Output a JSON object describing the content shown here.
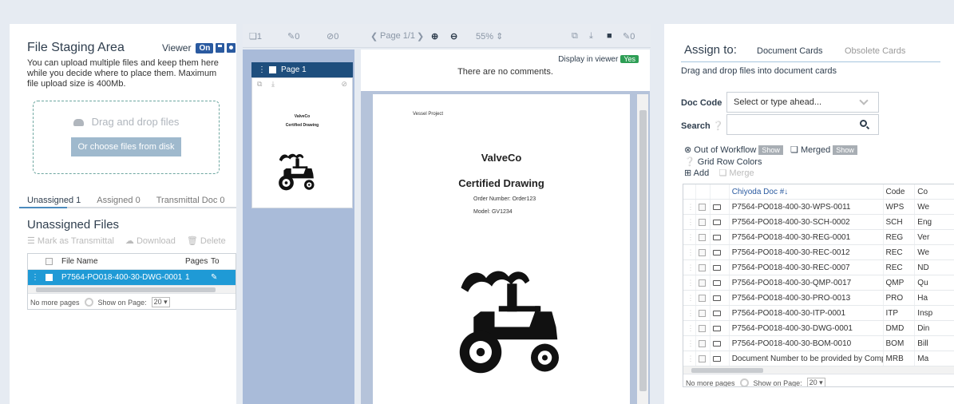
{
  "staging": {
    "title": "File Staging Area",
    "viewer_label": "Viewer",
    "viewer_toggle": "On",
    "description": "You can upload multiple files and keep them here while you decide where to place them. Maximum file upload size is 400Mb.",
    "drop_text": "Drag and drop files",
    "choose_button": "Or choose files from disk",
    "tabs": [
      "Unassigned 1",
      "Assigned 0",
      "Transmittal Doc 0"
    ],
    "unassigned_title": "Unassigned Files",
    "tools": {
      "mark": "Mark as Transmittal",
      "download": "Download",
      "delete": "Delete"
    },
    "table": {
      "headers": [
        "File Name",
        "Pages",
        "To"
      ],
      "rows": [
        {
          "file_name": "P7564-PO018-400-30-DWG-0001.pdf",
          "pages": "1"
        }
      ]
    },
    "pager": {
      "no_more": "No more pages",
      "show_label": "Show on Page:",
      "page_size": "20"
    }
  },
  "viewer_toolbar": {
    "pages_count": "1",
    "edits_count": "0",
    "voids_count": "0",
    "page_indicator": "Page 1/1",
    "zoom": "55%",
    "right_count": "0"
  },
  "thumbnail": {
    "label": "Page 1",
    "mini_title": "ValveCo",
    "mini_subtitle": "Certified Drawing"
  },
  "comments": {
    "display_label": "Display in viewer",
    "display_value": "Yes",
    "empty_text": "There are no comments."
  },
  "document": {
    "project": "Vessel Project",
    "company": "ValveCo",
    "title": "Certified Drawing",
    "order": "Order Number: Order123",
    "model": "Model: GV1234"
  },
  "assign": {
    "title": "Assign to:",
    "tab_document": "Document Cards",
    "tab_obsolete": "Obsolete Cards",
    "hint": "Drag and drop files into document cards",
    "doc_code_label": "Doc Code",
    "doc_code_placeholder": "Select or type ahead...",
    "search_label": "Search",
    "out_of_workflow": "Out of Workflow",
    "merged": "Merged",
    "show": "Show",
    "grid_row_colors": "Grid Row Colors",
    "add": "Add",
    "merge": "Merge",
    "grid": {
      "headers": [
        "Chiyoda Doc #",
        "Code",
        "Co"
      ],
      "rows": [
        {
          "doc": "P7564-PO018-400-30-WPS-0011",
          "code": "WPS",
          "co": "We"
        },
        {
          "doc": "P7564-PO018-400-30-SCH-0002",
          "code": "SCH",
          "co": "Eng"
        },
        {
          "doc": "P7564-PO018-400-30-REG-0001",
          "code": "REG",
          "co": "Ver"
        },
        {
          "doc": "P7564-PO018-400-30-REC-0012",
          "code": "REC",
          "co": "We"
        },
        {
          "doc": "P7564-PO018-400-30-REC-0007",
          "code": "REC",
          "co": "ND"
        },
        {
          "doc": "P7564-PO018-400-30-QMP-0017",
          "code": "QMP",
          "co": "Qu"
        },
        {
          "doc": "P7564-PO018-400-30-PRO-0013",
          "code": "PRO",
          "co": "Ha"
        },
        {
          "doc": "P7564-PO018-400-30-ITP-0001",
          "code": "ITP",
          "co": "Insp"
        },
        {
          "doc": "P7564-PO018-400-30-DWG-0001",
          "code": "DMD",
          "co": "Din"
        },
        {
          "doc": "P7564-PO018-400-30-BOM-0010",
          "code": "BOM",
          "co": "Bill"
        },
        {
          "doc": "Document Number to be provided by Company",
          "code": "MRB",
          "co": "Ma"
        }
      ]
    },
    "pager": {
      "no_more": "No more pages",
      "show_label": "Show on Page:",
      "page_size": "20"
    }
  }
}
